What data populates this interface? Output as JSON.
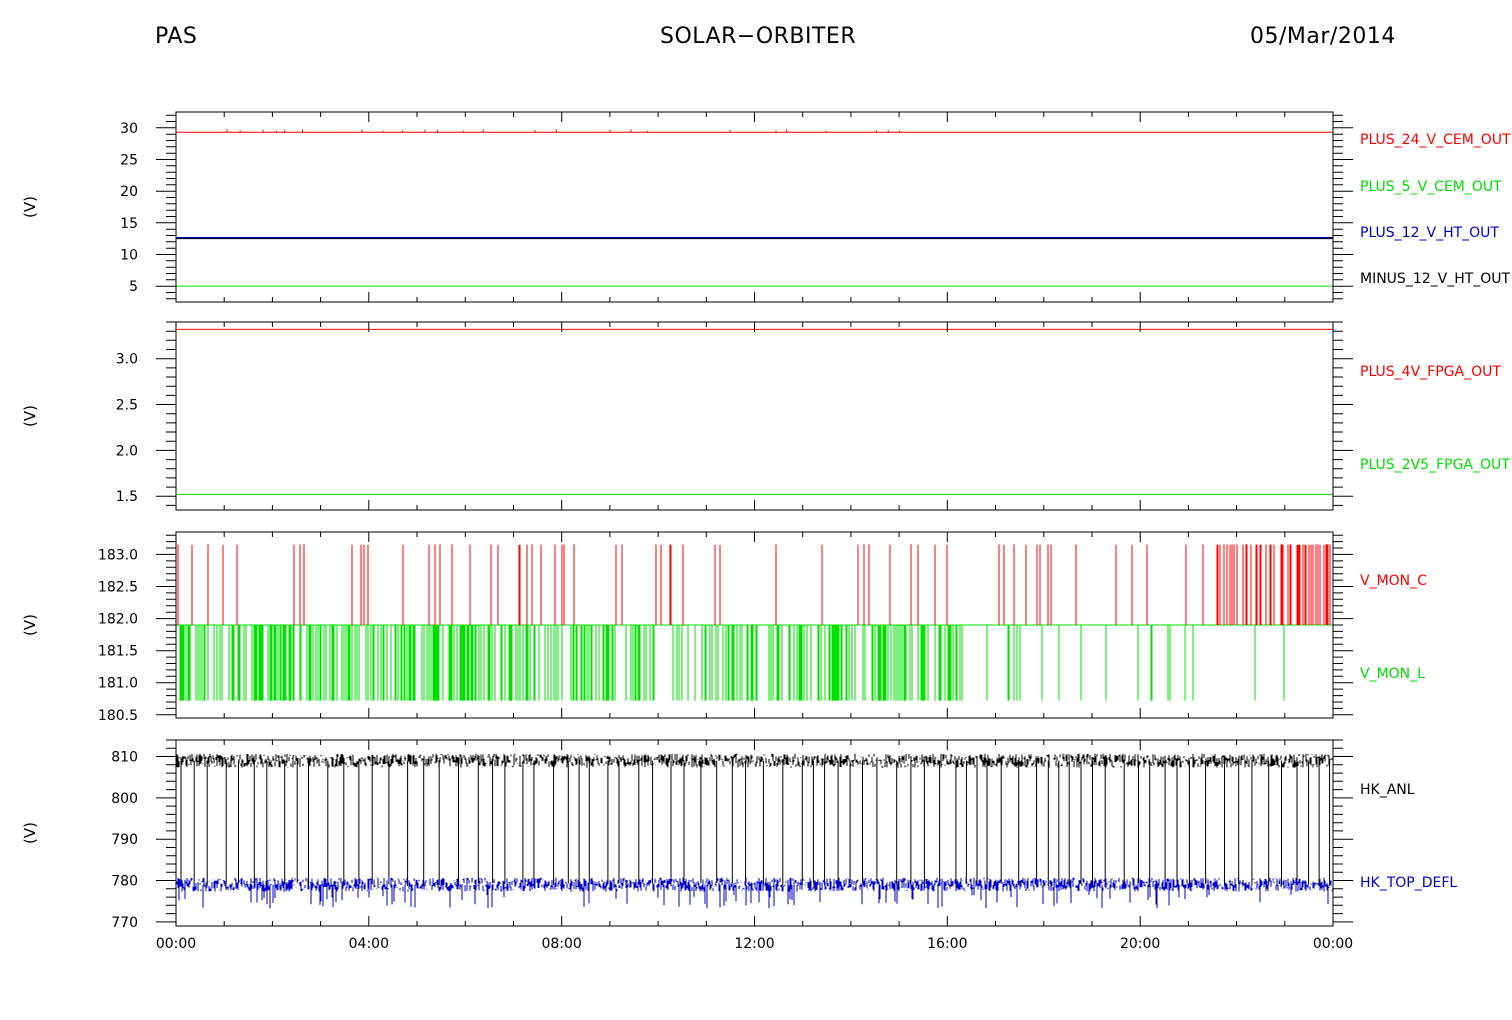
{
  "header": {
    "left": "PAS",
    "center": "SOLAR−ORBITER",
    "right": "05/Mar/2014"
  },
  "colors": {
    "red": "#ff0000",
    "green": "#00e000",
    "blue": "#0000c8",
    "black": "#000000"
  },
  "chart_data": [
    {
      "type": "line",
      "ylabel": "(V)",
      "ylim": [
        2.5,
        32.5
      ],
      "yticks": [
        5,
        10,
        15,
        20,
        25,
        30
      ],
      "ytick_labels": [
        "5",
        "10",
        "15",
        "20",
        "25",
        "30"
      ],
      "x": [
        "00:00",
        "24:00"
      ],
      "series": [
        {
          "name": "PLUS_24_V_CEM_OUT",
          "color": "#ff0000",
          "values": [
            29.3,
            29.3
          ]
        },
        {
          "name": "PLUS_5_V_CEM_OUT",
          "color": "#00e000",
          "values": [
            5.0,
            5.0
          ]
        },
        {
          "name": "PLUS_12_V_HT_OUT",
          "color": "#0000c8",
          "values": [
            12.6,
            12.6
          ]
        },
        {
          "name": "MINUS_12_V_HT_OUT",
          "color": "#000000",
          "values": [
            12.5,
            12.5
          ]
        }
      ]
    },
    {
      "type": "line",
      "ylabel": "(V)",
      "ylim": [
        1.35,
        3.4
      ],
      "yticks": [
        1.5,
        2.0,
        2.5,
        3.0
      ],
      "ytick_labels": [
        "1.5",
        "2.0",
        "2.5",
        "3.0"
      ],
      "x": [
        "00:00",
        "24:00"
      ],
      "series": [
        {
          "name": "PLUS_4V_FPGA_OUT",
          "color": "#ff0000",
          "values": [
            3.32,
            3.32
          ]
        },
        {
          "name": "PLUS_2V5_FPGA_OUT",
          "color": "#00e000",
          "values": [
            1.52,
            1.52
          ]
        }
      ]
    },
    {
      "type": "line",
      "ylabel": "(V)",
      "ylim": [
        180.45,
        183.35
      ],
      "yticks": [
        180.5,
        181.0,
        181.5,
        182.0,
        182.5,
        183.0
      ],
      "ytick_labels": [
        "180.5",
        "181.0",
        "181.5",
        "182.0",
        "182.5",
        "183.0"
      ],
      "baseline_values": {
        "V_MON_C": 181.9,
        "V_MON_L": 181.9
      },
      "spike_values": {
        "V_MON_C": 183.15,
        "V_MON_L": 180.72
      },
      "series": [
        {
          "name": "V_MON_C",
          "color": "#ff0000"
        },
        {
          "name": "V_MON_L",
          "color": "#00e000"
        }
      ]
    },
    {
      "type": "line",
      "ylabel": "(V)",
      "ylim": [
        769,
        814
      ],
      "yticks": [
        770,
        780,
        790,
        800,
        810
      ],
      "ytick_labels": [
        "770",
        "780",
        "790",
        "800",
        "810"
      ],
      "baseline_values": {
        "HK_ANL": 809,
        "HK_TOP_DEFL": 779
      },
      "series": [
        {
          "name": "HK_ANL",
          "color": "#000000"
        },
        {
          "name": "HK_TOP_DEFL",
          "color": "#0000c8"
        }
      ]
    }
  ],
  "xaxis": {
    "xlim_hours": [
      0,
      24
    ],
    "ticks_hours": [
      0,
      4,
      8,
      12,
      16,
      20,
      24
    ],
    "tick_labels": [
      "00:00",
      "04:00",
      "08:00",
      "12:00",
      "16:00",
      "20:00",
      "00:00"
    ]
  }
}
